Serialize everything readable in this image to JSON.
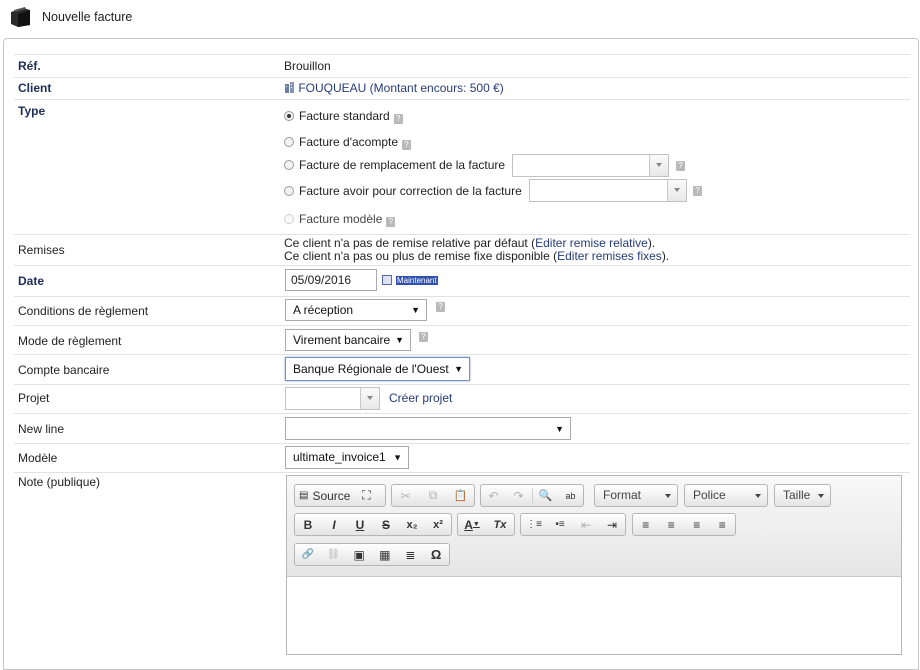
{
  "header": {
    "title": "Nouvelle facture"
  },
  "form": {
    "ref": {
      "label": "Réf.",
      "value": "Brouillon"
    },
    "client": {
      "label": "Client",
      "value": "FOUQUEAU (Montant encours: 500 €)"
    },
    "type": {
      "label": "Type",
      "options": [
        {
          "label": "Facture standard",
          "checked": true,
          "disabled": false
        },
        {
          "label": "Facture d'acompte",
          "checked": false,
          "disabled": false
        },
        {
          "label": "Facture de remplacement de la facture",
          "checked": false,
          "disabled": false
        },
        {
          "label": "Facture avoir pour correction de la facture",
          "checked": false,
          "disabled": false
        },
        {
          "label": "Facture modèle",
          "checked": false,
          "disabled": true
        }
      ]
    },
    "remises": {
      "label": "Remises",
      "line1_text": "Ce client n'a pas de remise relative par défaut (",
      "line1_link": "Editer remise relative",
      "line1_end": ").",
      "line2_text": "Ce client n'a pas ou plus de remise fixe disponible (",
      "line2_link": "Editer remises fixes",
      "line2_end": ")."
    },
    "date": {
      "label": "Date",
      "value": "05/09/2016",
      "now_button": "Maintenant"
    },
    "conditions": {
      "label": "Conditions de règlement",
      "value": "A réception"
    },
    "mode": {
      "label": "Mode de règlement",
      "value": "Virement bancaire"
    },
    "compte": {
      "label": "Compte bancaire",
      "value": "Banque Régionale de l'Ouest"
    },
    "projet": {
      "label": "Projet",
      "value": "",
      "create_link": "Créer projet"
    },
    "new_line": {
      "label": "New line",
      "value": ""
    },
    "modele": {
      "label": "Modèle",
      "value": "ultimate_invoice1"
    },
    "note": {
      "label": "Note (publique)"
    }
  },
  "editor": {
    "source_label": "Source",
    "format_label": "Format",
    "font_label": "Police",
    "size_label": "Taille",
    "icons": {
      "maximize": "⛶",
      "cut": "✂",
      "copy": "⧉",
      "paste": "📋",
      "undo": "↶",
      "redo": "↷",
      "find": "🔍",
      "replace": "ab",
      "bold": "B",
      "italic": "I",
      "underline": "U",
      "strike": "S",
      "subscript": "x₂",
      "superscript": "x²",
      "text_color": "A",
      "remove_format": "Tx",
      "ordered_list": "⋮≡",
      "bulleted_list": "•≡",
      "outdent": "⇤",
      "indent": "⇥",
      "align_left": "≡",
      "align_center": "≡",
      "align_right": "≡",
      "justify": "≡",
      "link": "🔗",
      "unlink": "⛓",
      "image": "▣",
      "table": "▦",
      "hr": "≣",
      "special_char": "Ω"
    }
  }
}
